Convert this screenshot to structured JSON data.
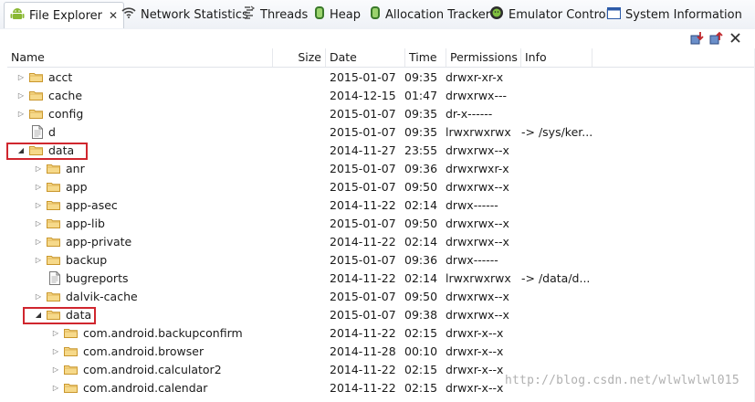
{
  "tabs": [
    {
      "label": "File Explorer",
      "icon": "android-icon",
      "active": true
    },
    {
      "label": "Network Statistics",
      "icon": "wifi-icon"
    },
    {
      "label": "Threads",
      "icon": "threads-icon"
    },
    {
      "label": "Heap",
      "icon": "heap-icon"
    },
    {
      "label": "Allocation Tracker",
      "icon": "allocation-icon"
    },
    {
      "label": "Emulator Control",
      "icon": "emulator-icon"
    },
    {
      "label": "System Information",
      "icon": "window-icon"
    }
  ],
  "tab_close_glyph": "✕",
  "columns": {
    "name": "Name",
    "size": "Size",
    "date": "Date",
    "time": "Time",
    "permissions": "Permissions",
    "info": "Info"
  },
  "rows": [
    {
      "level": 0,
      "state": "collapsed",
      "type": "folder",
      "name": "acct",
      "date": "2015-01-07",
      "time": "09:35",
      "perm": "drwxr-xr-x",
      "info": ""
    },
    {
      "level": 0,
      "state": "collapsed",
      "type": "folder",
      "name": "cache",
      "date": "2014-12-15",
      "time": "01:47",
      "perm": "drwxrwx---",
      "info": ""
    },
    {
      "level": 0,
      "state": "collapsed",
      "type": "folder",
      "name": "config",
      "date": "2015-01-07",
      "time": "09:35",
      "perm": "dr-x------",
      "info": ""
    },
    {
      "level": 0,
      "state": "none",
      "type": "file",
      "name": "d",
      "date": "2015-01-07",
      "time": "09:35",
      "perm": "lrwxrwxrwx",
      "info": "-> /sys/ker..."
    },
    {
      "level": 0,
      "state": "expanded",
      "type": "folder",
      "name": "data",
      "date": "2014-11-27",
      "time": "23:55",
      "perm": "drwxrwx--x",
      "info": "",
      "highlight": true
    },
    {
      "level": 1,
      "state": "collapsed",
      "type": "folder",
      "name": "anr",
      "date": "2015-01-07",
      "time": "09:36",
      "perm": "drwxrwxr-x",
      "info": ""
    },
    {
      "level": 1,
      "state": "collapsed",
      "type": "folder",
      "name": "app",
      "date": "2015-01-07",
      "time": "09:50",
      "perm": "drwxrwx--x",
      "info": ""
    },
    {
      "level": 1,
      "state": "collapsed",
      "type": "folder",
      "name": "app-asec",
      "date": "2014-11-22",
      "time": "02:14",
      "perm": "drwx------",
      "info": ""
    },
    {
      "level": 1,
      "state": "collapsed",
      "type": "folder",
      "name": "app-lib",
      "date": "2015-01-07",
      "time": "09:50",
      "perm": "drwxrwx--x",
      "info": ""
    },
    {
      "level": 1,
      "state": "collapsed",
      "type": "folder",
      "name": "app-private",
      "date": "2014-11-22",
      "time": "02:14",
      "perm": "drwxrwx--x",
      "info": ""
    },
    {
      "level": 1,
      "state": "collapsed",
      "type": "folder",
      "name": "backup",
      "date": "2015-01-07",
      "time": "09:36",
      "perm": "drwx------",
      "info": ""
    },
    {
      "level": 1,
      "state": "none",
      "type": "file",
      "name": "bugreports",
      "date": "2014-11-22",
      "time": "02:14",
      "perm": "lrwxrwxrwx",
      "info": "-> /data/d..."
    },
    {
      "level": 1,
      "state": "collapsed",
      "type": "folder",
      "name": "dalvik-cache",
      "date": "2015-01-07",
      "time": "09:50",
      "perm": "drwxrwx--x",
      "info": ""
    },
    {
      "level": 1,
      "state": "expanded",
      "type": "folder",
      "name": "data",
      "date": "2015-01-07",
      "time": "09:38",
      "perm": "drwxrwx--x",
      "info": "",
      "highlight": true
    },
    {
      "level": 2,
      "state": "collapsed",
      "type": "folder",
      "name": "com.android.backupconfirm",
      "date": "2014-11-22",
      "time": "02:15",
      "perm": "drwxr-x--x",
      "info": ""
    },
    {
      "level": 2,
      "state": "collapsed",
      "type": "folder",
      "name": "com.android.browser",
      "date": "2014-11-28",
      "time": "00:10",
      "perm": "drwxr-x--x",
      "info": ""
    },
    {
      "level": 2,
      "state": "collapsed",
      "type": "folder",
      "name": "com.android.calculator2",
      "date": "2014-11-22",
      "time": "02:15",
      "perm": "drwxr-x--x",
      "info": ""
    },
    {
      "level": 2,
      "state": "collapsed",
      "type": "folder",
      "name": "com.android.calendar",
      "date": "2014-11-22",
      "time": "02:15",
      "perm": "drwxr-x--x",
      "info": ""
    }
  ],
  "watermark": "http://blog.csdn.net/wlwlwlwl015",
  "colors": {
    "highlight_border": "#d0262e",
    "folder_fill": "#f6d98a",
    "folder_stroke": "#c9962b"
  }
}
